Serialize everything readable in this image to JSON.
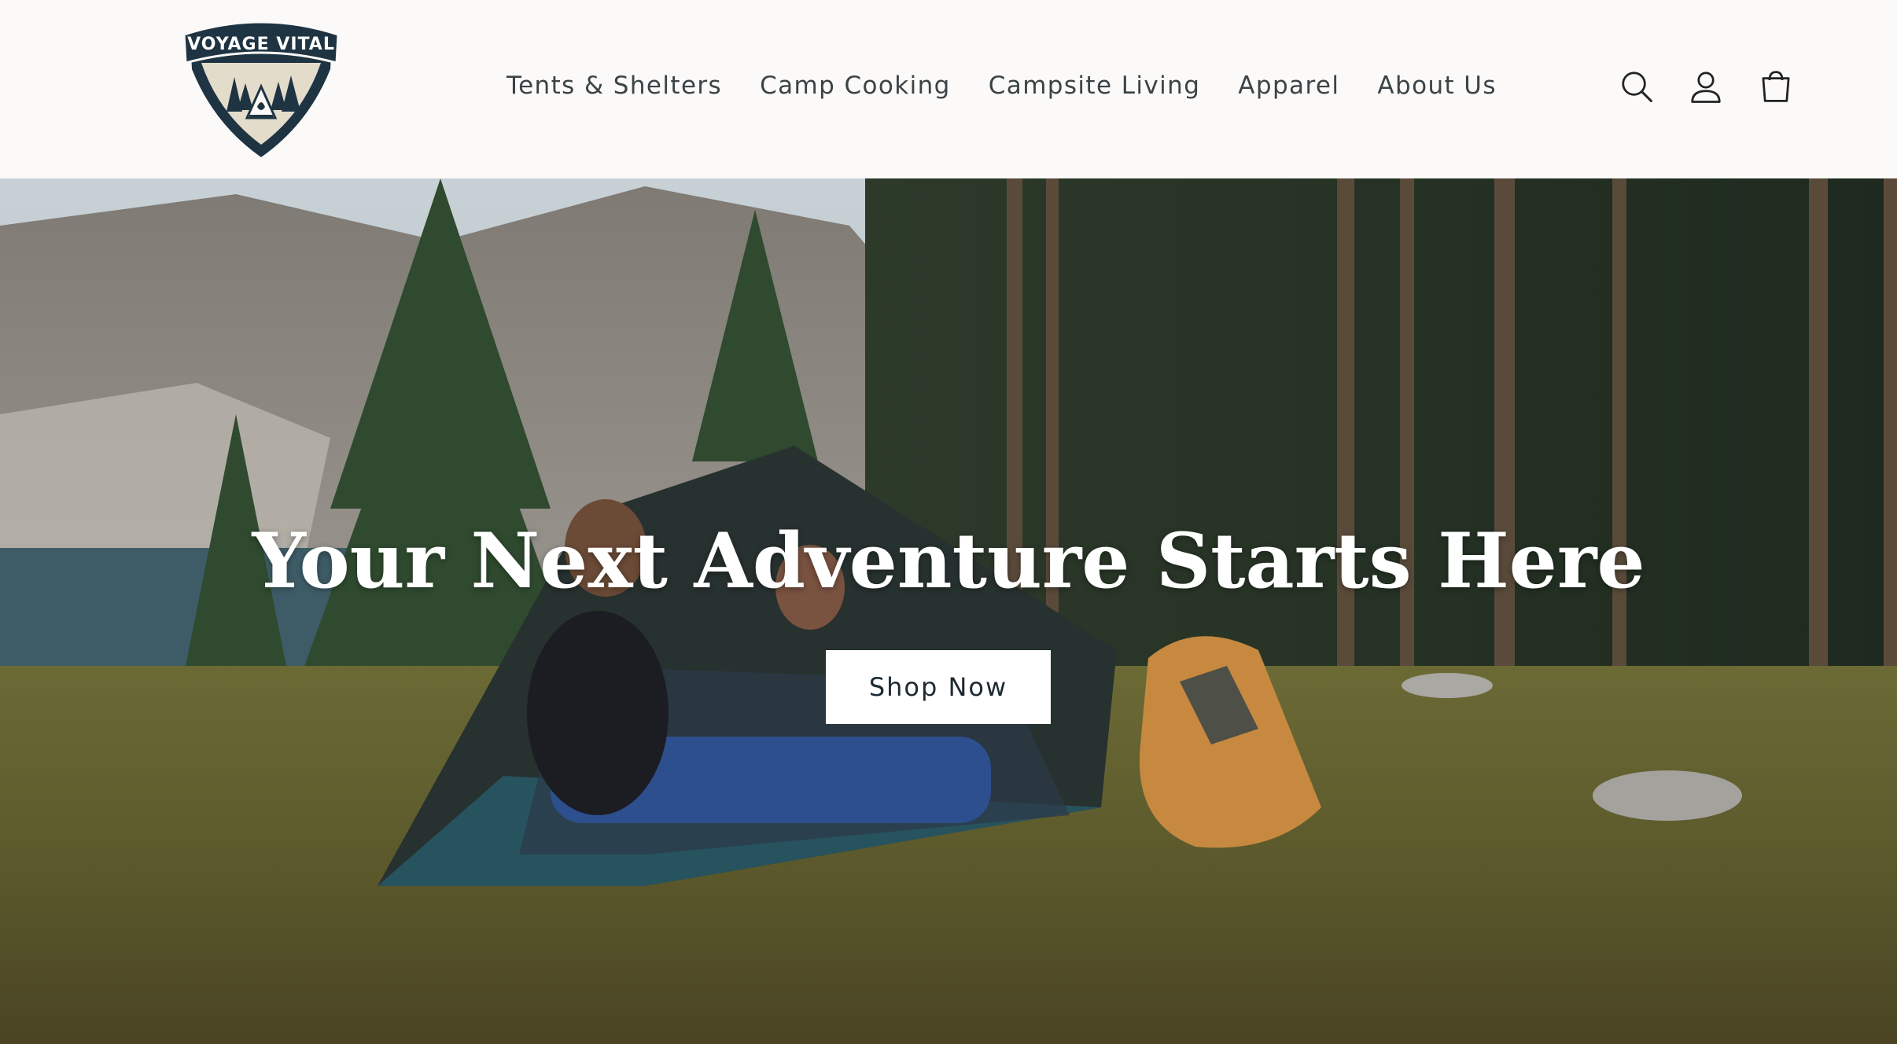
{
  "brand": {
    "logo_text": "VOYAGE VITAL",
    "colors": {
      "navy": "#1f3442",
      "cream": "#e4dccb",
      "header_bg": "#fbfaf8"
    }
  },
  "nav": {
    "items": [
      {
        "label": "Tents & Shelters"
      },
      {
        "label": "Camp Cooking"
      },
      {
        "label": "Campsite Living"
      },
      {
        "label": "Apparel"
      },
      {
        "label": "About Us"
      }
    ]
  },
  "header_icons": {
    "search": "search-icon",
    "account": "account-icon",
    "cart": "cart-icon"
  },
  "hero": {
    "title": "Your Next Adventure Starts Here",
    "button_label": "Shop Now",
    "image": "campsite-tent-scene"
  }
}
